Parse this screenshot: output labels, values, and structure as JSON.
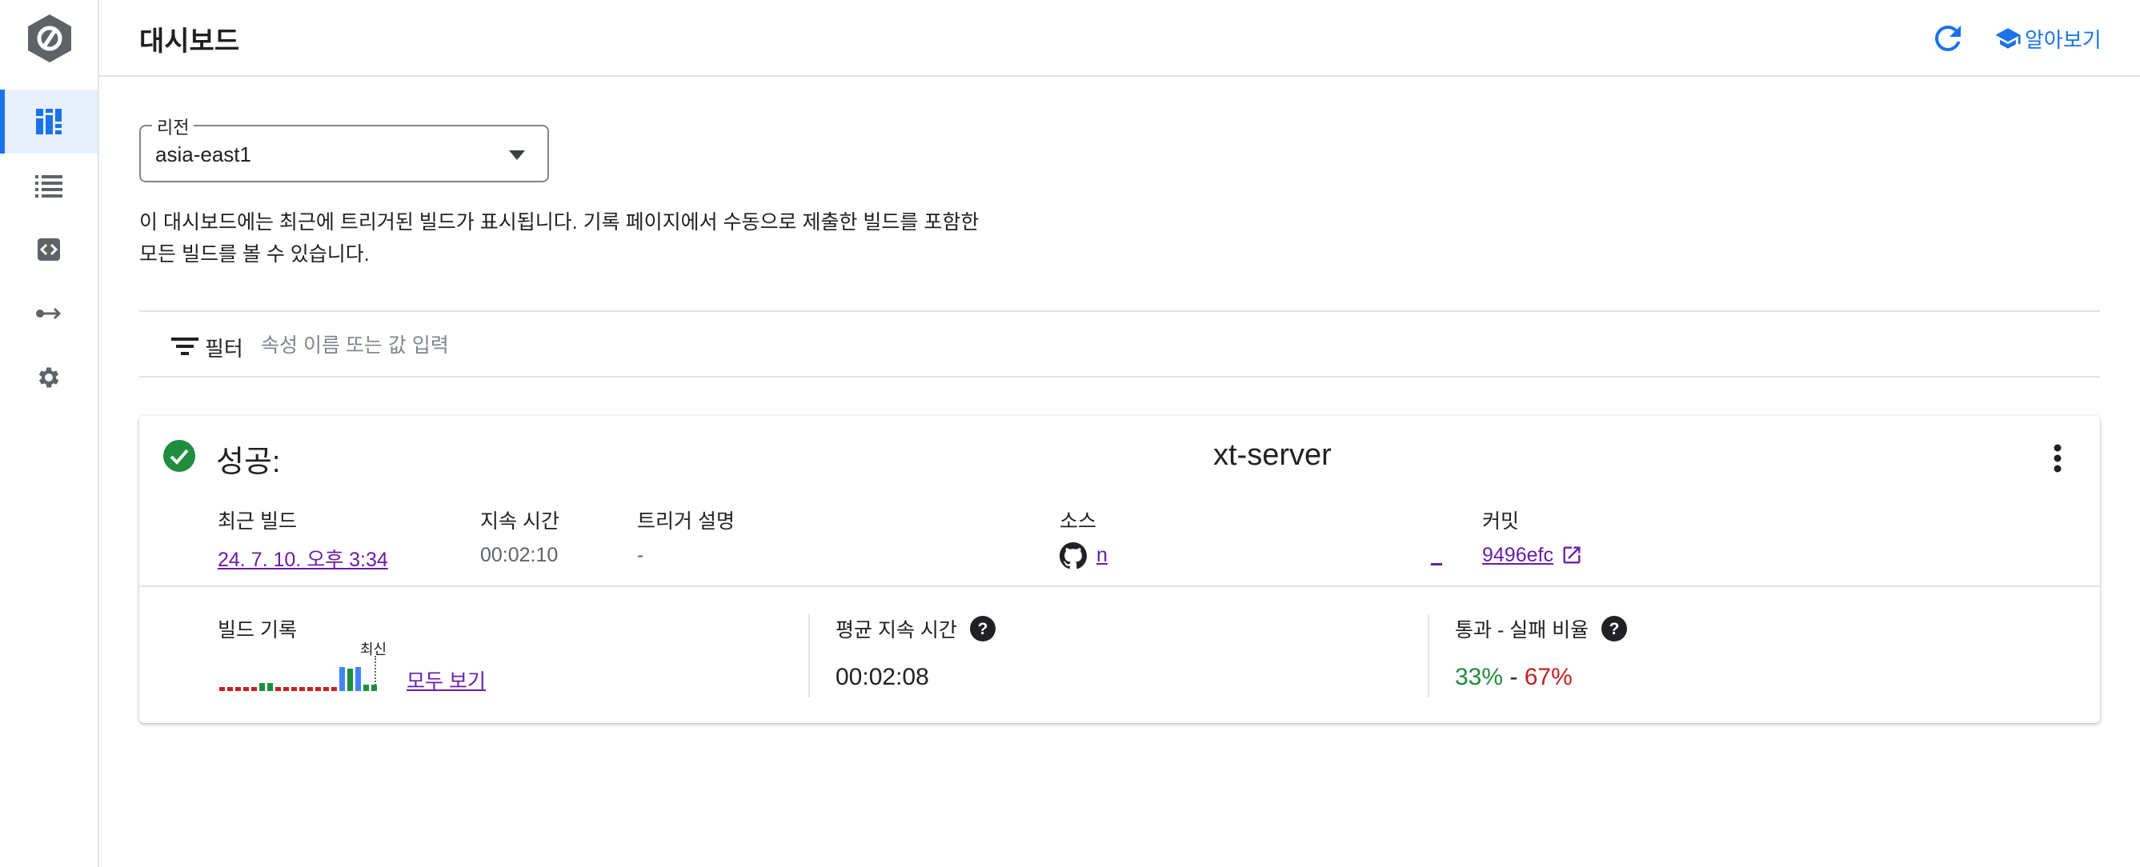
{
  "header": {
    "title": "대시보드",
    "learn_label": "알아보기"
  },
  "nav": {
    "items": [
      {
        "icon": "dashboard-icon",
        "active": true
      },
      {
        "icon": "history-list-icon",
        "active": false
      },
      {
        "icon": "triggers-icon",
        "active": false
      },
      {
        "icon": "repositories-icon",
        "active": false
      },
      {
        "icon": "settings-icon",
        "active": false
      }
    ]
  },
  "region": {
    "label": "리전",
    "value": "asia-east1"
  },
  "description": {
    "line1": "이 대시보드에는 최근에 트리거된 빌드가 표시됩니다. 기록 페이지에서 수동으로 제출한 빌드를 포함한",
    "line2": "모든 빌드를 볼 수 있습니다."
  },
  "filter": {
    "label": "필터",
    "placeholder": "속성 이름 또는 값 입력"
  },
  "card": {
    "status": "성공:",
    "trigger_name": "xt-server",
    "columns": {
      "latest_build": {
        "header": "최근 빌드",
        "value": "24. 7. 10. 오후 3:34"
      },
      "duration": {
        "header": "지속 시간",
        "value": "00:02:10"
      },
      "trigger_desc": {
        "header": "트리거 설명",
        "value": "-"
      },
      "source": {
        "header": "소스",
        "value": "n",
        "value2": "_"
      },
      "commit": {
        "header": "커밋",
        "value": "9496efc"
      }
    },
    "build_history": {
      "header": "빌드 기록",
      "latest_label": "최신",
      "view_all": "모두 보기",
      "runs": [
        "fail",
        "fail",
        "fail",
        "fail",
        "fail",
        "success",
        "success",
        "fail",
        "fail",
        "fail",
        "fail",
        "fail",
        "fail",
        "fail",
        "fail",
        "running",
        "success",
        "running",
        "success",
        "success"
      ]
    },
    "avg_duration": {
      "header": "평균 지속 시간",
      "value": "00:02:08"
    },
    "pass_fail": {
      "header": "통과 - 실패 비율",
      "pass": "33%",
      "sep": " - ",
      "fail": "67%"
    }
  },
  "colors": {
    "accent": "#1a73e8",
    "success": "#1e8e3e",
    "failure": "#c5221f",
    "link": "#681da8"
  }
}
